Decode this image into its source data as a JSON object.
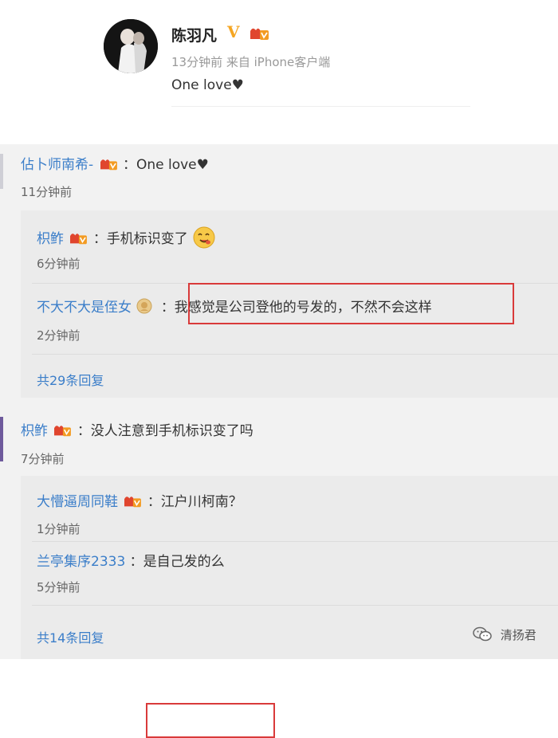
{
  "post": {
    "username": "陈羽凡",
    "verified_mark": "V",
    "meta": "13分钟前 来自 iPhone客户端",
    "text": "One love♥"
  },
  "threads": [
    {
      "author": "佔卜师南希-",
      "content": "：One love♥",
      "time": "11分钟前",
      "replies": [
        {
          "author": "枳鲊",
          "content": "：手机标识变了",
          "time": "6分钟前",
          "emoji": "hungry-face-emoji"
        },
        {
          "author": "不大不大是侄女",
          "content": "：我感觉是公司登他的号发的，不然不会这样",
          "time": "2分钟前",
          "highlighted": true
        }
      ],
      "more_replies": "共29条回复"
    },
    {
      "author": "枳鲊",
      "content": "：没人注意到手机标识变了吗",
      "time": "7分钟前",
      "replies": [
        {
          "author": "大懵逼周同鞋",
          "content": "：江户川柯南？",
          "time": "1分钟前"
        },
        {
          "author": "兰亭集序2333",
          "content": "：是自己发的么",
          "time": "5分钟前",
          "highlighted": true
        }
      ],
      "more_replies": "共14条回复"
    }
  ],
  "watermark": {
    "text": "清扬君",
    "icon": "wechat-icon"
  },
  "colors": {
    "link": "#3b7ec9",
    "highlight_border": "#d93a3a",
    "verified": "#f5a623",
    "thread1_bar": "#cfcfd6",
    "thread2_bar": "#6e5a9c"
  }
}
